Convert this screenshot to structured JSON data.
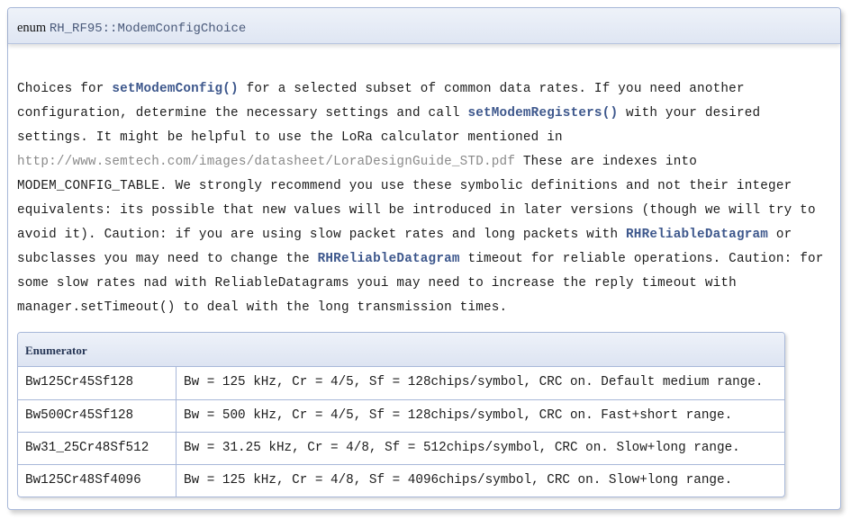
{
  "header": {
    "keyword": "enum",
    "name": "RH_RF95::ModemConfigChoice"
  },
  "description": {
    "lines": [
      [
        {
          "t": "Choices for ",
          "s": "text"
        },
        {
          "t": "setModemConfig()",
          "s": "code"
        },
        {
          "t": " for a selected subset of common data rates. If you need another",
          "s": "text"
        }
      ],
      [
        {
          "t": "configuration, determine the necessary settings and call ",
          "s": "text"
        },
        {
          "t": "setModemRegisters()",
          "s": "code"
        },
        {
          "t": " with your desired",
          "s": "text"
        }
      ],
      [
        {
          "t": "settings. It might be helpful to use the LoRa calculator mentioned in",
          "s": "text"
        }
      ],
      [
        {
          "t": "http://www.semtech.com/images/datasheet/LoraDesignGuide_STD.pdf",
          "s": "url"
        },
        {
          "t": " These are indexes into",
          "s": "text"
        }
      ],
      [
        {
          "t": "MODEM_CONFIG_TABLE. We strongly recommend you use these symbolic definitions and not their integer",
          "s": "text"
        }
      ],
      [
        {
          "t": "equivalents: its possible that new values will be introduced in later versions (though we will try to",
          "s": "text"
        }
      ],
      [
        {
          "t": "avoid it). Caution: if you are using slow packet rates and long packets with ",
          "s": "text"
        },
        {
          "t": "RHReliableDatagram",
          "s": "code"
        },
        {
          "t": " or",
          "s": "text"
        }
      ],
      [
        {
          "t": "subclasses you may need to change the ",
          "s": "text"
        },
        {
          "t": "RHReliableDatagram",
          "s": "code"
        },
        {
          "t": " timeout for reliable operations. Caution: for",
          "s": "text"
        }
      ],
      [
        {
          "t": "some slow rates nad with ReliableDatagrams youi may need to increase the reply timeout with",
          "s": "text"
        }
      ],
      [
        {
          "t": "manager.setTimeout() to deal with the long transmission times.",
          "s": "text"
        }
      ]
    ]
  },
  "enum_table": {
    "header": "Enumerator",
    "rows": [
      {
        "name": "Bw125Cr45Sf128",
        "doc": "Bw = 125 kHz, Cr = 4/5, Sf = 128chips/symbol, CRC on. Default medium range."
      },
      {
        "name": "Bw500Cr45Sf128",
        "doc": "Bw = 500 kHz, Cr = 4/5, Sf = 128chips/symbol, CRC on. Fast+short range."
      },
      {
        "name": "Bw31_25Cr48Sf512",
        "doc": "Bw = 31.25 kHz, Cr = 4/8, Sf = 512chips/symbol, CRC on. Slow+long range."
      },
      {
        "name": "Bw125Cr48Sf4096",
        "doc": "Bw = 125 kHz, Cr = 4/8, Sf = 4096chips/symbol, CRC on. Slow+long range."
      }
    ]
  },
  "colors": {
    "code_link": "#3d578c",
    "url": "#8a8a8a",
    "border": "#a8b8d9"
  }
}
